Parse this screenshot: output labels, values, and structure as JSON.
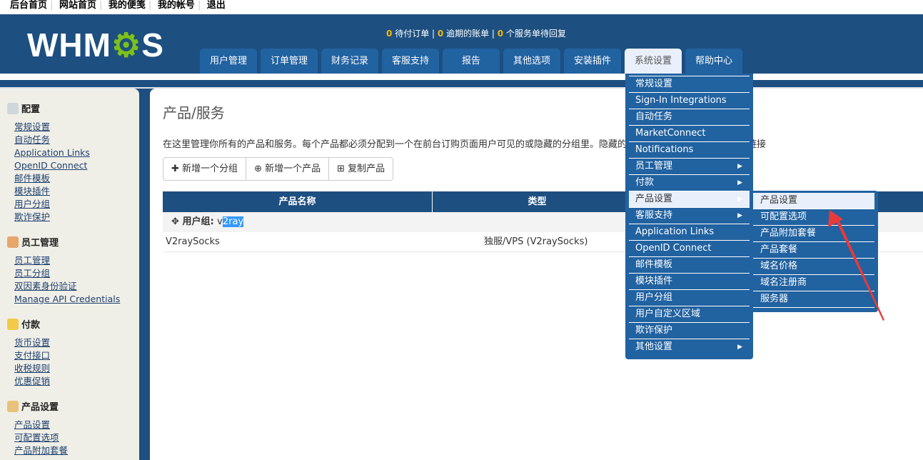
{
  "topbar": {
    "links": [
      "后台首页",
      "网站首页",
      "我的便笺",
      "我的帐号",
      "退出"
    ]
  },
  "logo": {
    "text_a": "WHM",
    "text_gear": "⚙",
    "text_b": "S"
  },
  "alerts": {
    "pending_orders_count": "0",
    "pending_orders": "待付订单",
    "overdue_count": "0",
    "overdue": "逾期的账单",
    "tickets_count": "0",
    "tickets": "个服务单待回复"
  },
  "nav": {
    "tabs": [
      "用户管理",
      "订单管理",
      "财务记录",
      "客服支持",
      "报告",
      "其他选项",
      "安装插件",
      "系统设置",
      "帮助中心"
    ],
    "active": "系统设置"
  },
  "sidebar": {
    "groups": [
      {
        "title": "配置",
        "icon": "config-icon",
        "links": [
          "常规设置",
          "自动任务",
          "Application Links",
          "OpenID Connect",
          "邮件模板",
          "模块插件",
          "用户分组",
          "欺诈保护"
        ]
      },
      {
        "title": "员工管理",
        "icon": "staff-icon",
        "links": [
          "员工管理",
          "员工分组",
          "双因素身份验证",
          "Manage API Credentials"
        ]
      },
      {
        "title": "付款",
        "icon": "coins-icon",
        "links": [
          "货币设置",
          "支付接口",
          "收税规则",
          "优惠促销"
        ]
      },
      {
        "title": "产品设置",
        "icon": "box-icon",
        "links": [
          "产品设置",
          "可配置选项",
          "产品附加套餐"
        ]
      }
    ]
  },
  "main": {
    "title": "产品/服务",
    "description": "在这里管理你所有的产品和服务。每个产品都必须分配到一个在前台订购页面用户可见的或隐藏的分组里。隐藏的产品仍然可以使用直接的地址链接",
    "buttons": [
      "新增一个分组",
      "新增一个产品",
      "复制产品"
    ],
    "table": {
      "headers": [
        "产品名称",
        "类型",
        ""
      ],
      "group_label": "用户组:",
      "group_prefix": "v",
      "group_selected": "2ray",
      "rows": [
        {
          "name": "V2raySocks",
          "type": "独服/VPS (V2raySocks)"
        }
      ]
    }
  },
  "menu": {
    "items": [
      {
        "label": "常规设置",
        "sub": false
      },
      {
        "label": "Sign-In Integrations",
        "sub": false
      },
      {
        "label": "自动任务",
        "sub": false
      },
      {
        "label": "MarketConnect",
        "sub": false
      },
      {
        "label": "Notifications",
        "sub": false
      },
      {
        "label": "员工管理",
        "sub": true
      },
      {
        "label": "付款",
        "sub": true
      },
      {
        "label": "产品设置",
        "sub": true,
        "active": true
      },
      {
        "label": "客服支持",
        "sub": true
      },
      {
        "label": "Application Links",
        "sub": false
      },
      {
        "label": "OpenID Connect",
        "sub": false
      },
      {
        "label": "邮件模板",
        "sub": false
      },
      {
        "label": "模块插件",
        "sub": false
      },
      {
        "label": "用户分组",
        "sub": false
      },
      {
        "label": "用户自定义区域",
        "sub": false
      },
      {
        "label": "欺诈保护",
        "sub": false
      },
      {
        "label": "其他设置",
        "sub": true
      }
    ],
    "submenu": [
      "产品设置",
      "可配置选项",
      "产品附加套餐",
      "产品套餐",
      "域名价格",
      "域名注册商",
      "服务器"
    ],
    "submenu_active": "产品设置"
  },
  "colors": {
    "header": "#1d4f80",
    "tab": "#2162a1",
    "accent": "#f5b800",
    "annotation_arrow": "#e83a3a"
  }
}
